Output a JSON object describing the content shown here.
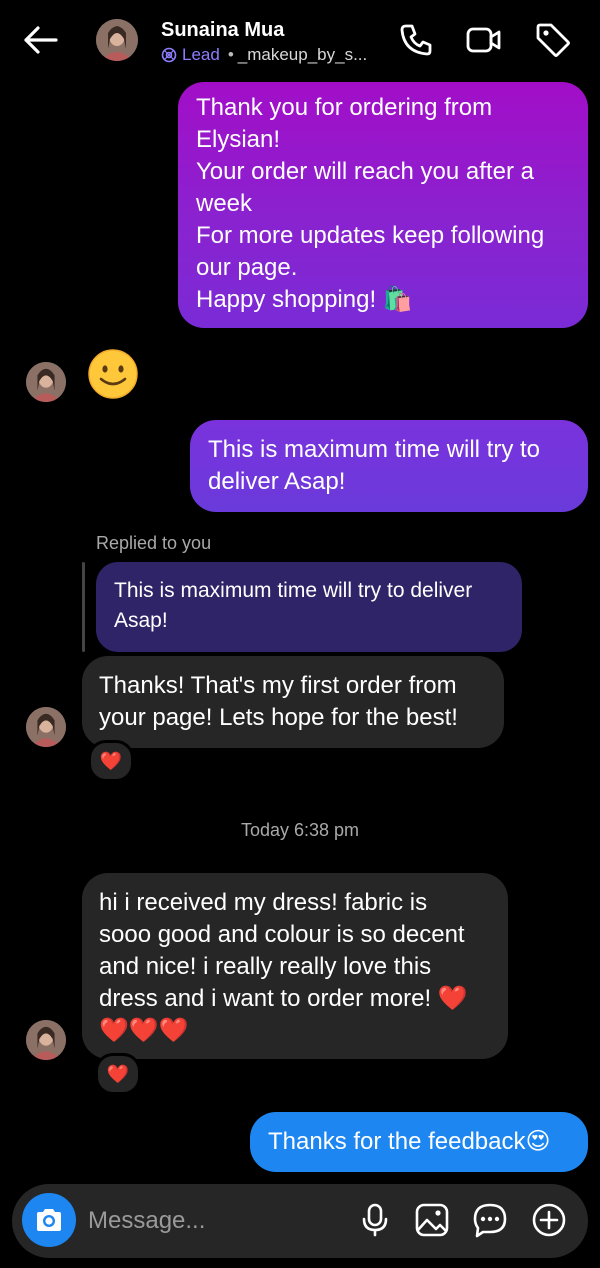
{
  "header": {
    "contact_name": "Sunaina Mua",
    "label": "Lead",
    "separator": "•",
    "username": "_makeup_by_s..."
  },
  "messages": {
    "m1_lines": [
      "Thank you for ordering from",
      "Elysian!",
      "Your order will reach you after a",
      "week",
      "For more updates keep following",
      "our page.",
      "Happy shopping! 🛍️"
    ],
    "m2_emoji": "🙂",
    "m3_lines": [
      "This is maximum time will try to",
      "deliver Asap!"
    ],
    "replied_label": "Replied to you",
    "quoted_lines": [
      "This is maximum time will try to deliver",
      "Asap!"
    ],
    "m4_lines": [
      "Thanks! That's my first order from",
      "your page! Lets hope for the best!"
    ],
    "m4_reaction": "❤️",
    "timestamp": "Today 6:38 pm",
    "m5_lines": [
      "hi i received my dress! fabric is",
      "sooo good and colour is so decent",
      "and nice! i really really love this",
      "dress and i want to order more! ❤️",
      "❤️❤️❤️"
    ],
    "m5_reaction": "❤️",
    "m6_text": "Thanks for the feedback😍"
  },
  "composer": {
    "placeholder": "Message..."
  },
  "colors": {
    "outgoing_gradient_top": "#a20ec8",
    "outgoing_gradient_bottom": "#7a2bd6",
    "incoming_bubble": "#262626",
    "sent_blue": "#1d86f0",
    "lead_purple": "#8f7dff"
  },
  "icons": [
    "back-arrow-icon",
    "lead-icon",
    "phone-icon",
    "video-icon",
    "tag-icon",
    "camera-icon",
    "microphone-icon",
    "image-icon",
    "sticker-icon",
    "plus-icon"
  ]
}
